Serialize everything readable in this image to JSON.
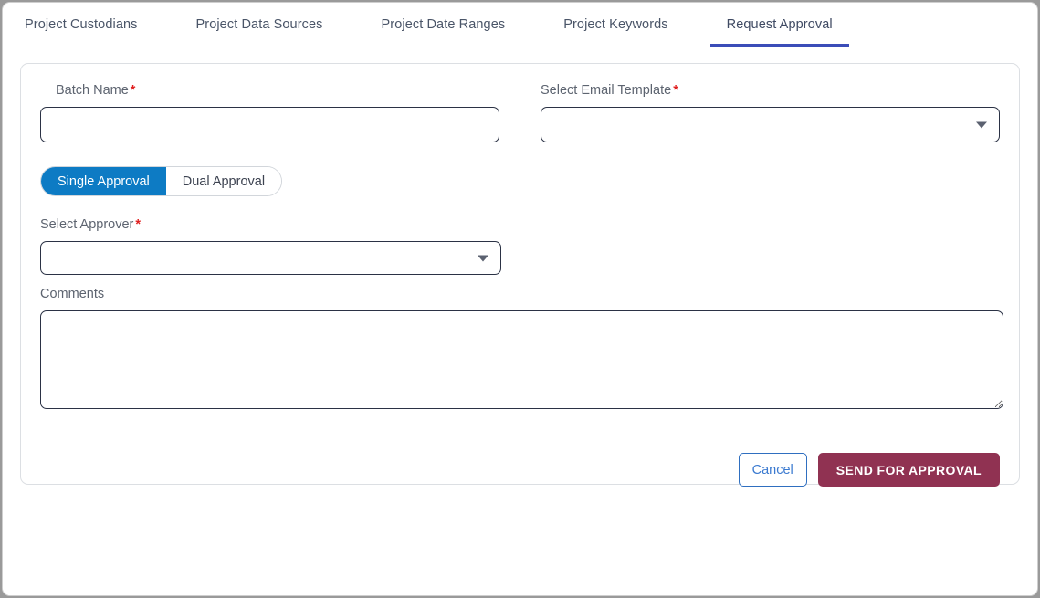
{
  "tabs": [
    {
      "label": "Project Custodians",
      "active": false
    },
    {
      "label": "Project Data Sources",
      "active": false
    },
    {
      "label": "Project Date Ranges",
      "active": false
    },
    {
      "label": "Project Keywords",
      "active": false
    },
    {
      "label": "Request Approval",
      "active": true
    }
  ],
  "form": {
    "batch_name": {
      "label": "Batch Name",
      "required_marker": "*",
      "value": "",
      "placeholder": ""
    },
    "email_template": {
      "label": "Select Email Template",
      "required_marker": "*",
      "value": "",
      "placeholder": "",
      "caret_icon": "chevron-down-icon"
    },
    "approval_mode": {
      "options": [
        "Single Approval",
        "Dual Approval"
      ],
      "selected": "Single Approval"
    },
    "approver": {
      "label": "Select Approver",
      "required_marker": "*",
      "value": "",
      "placeholder": "",
      "caret_icon": "chevron-down-icon"
    },
    "comments": {
      "label": "Comments",
      "value": "",
      "placeholder": ""
    }
  },
  "actions": {
    "cancel_label": "Cancel",
    "submit_label": "SEND FOR APPROVAL"
  },
  "colors": {
    "accent_tab_underline": "#3b4db8",
    "toggle_active": "#0d7bc4",
    "submit_button": "#903252",
    "cancel_border": "#2f6fc0",
    "required_asterisk": "#e02020",
    "input_border": "#2b3245"
  }
}
